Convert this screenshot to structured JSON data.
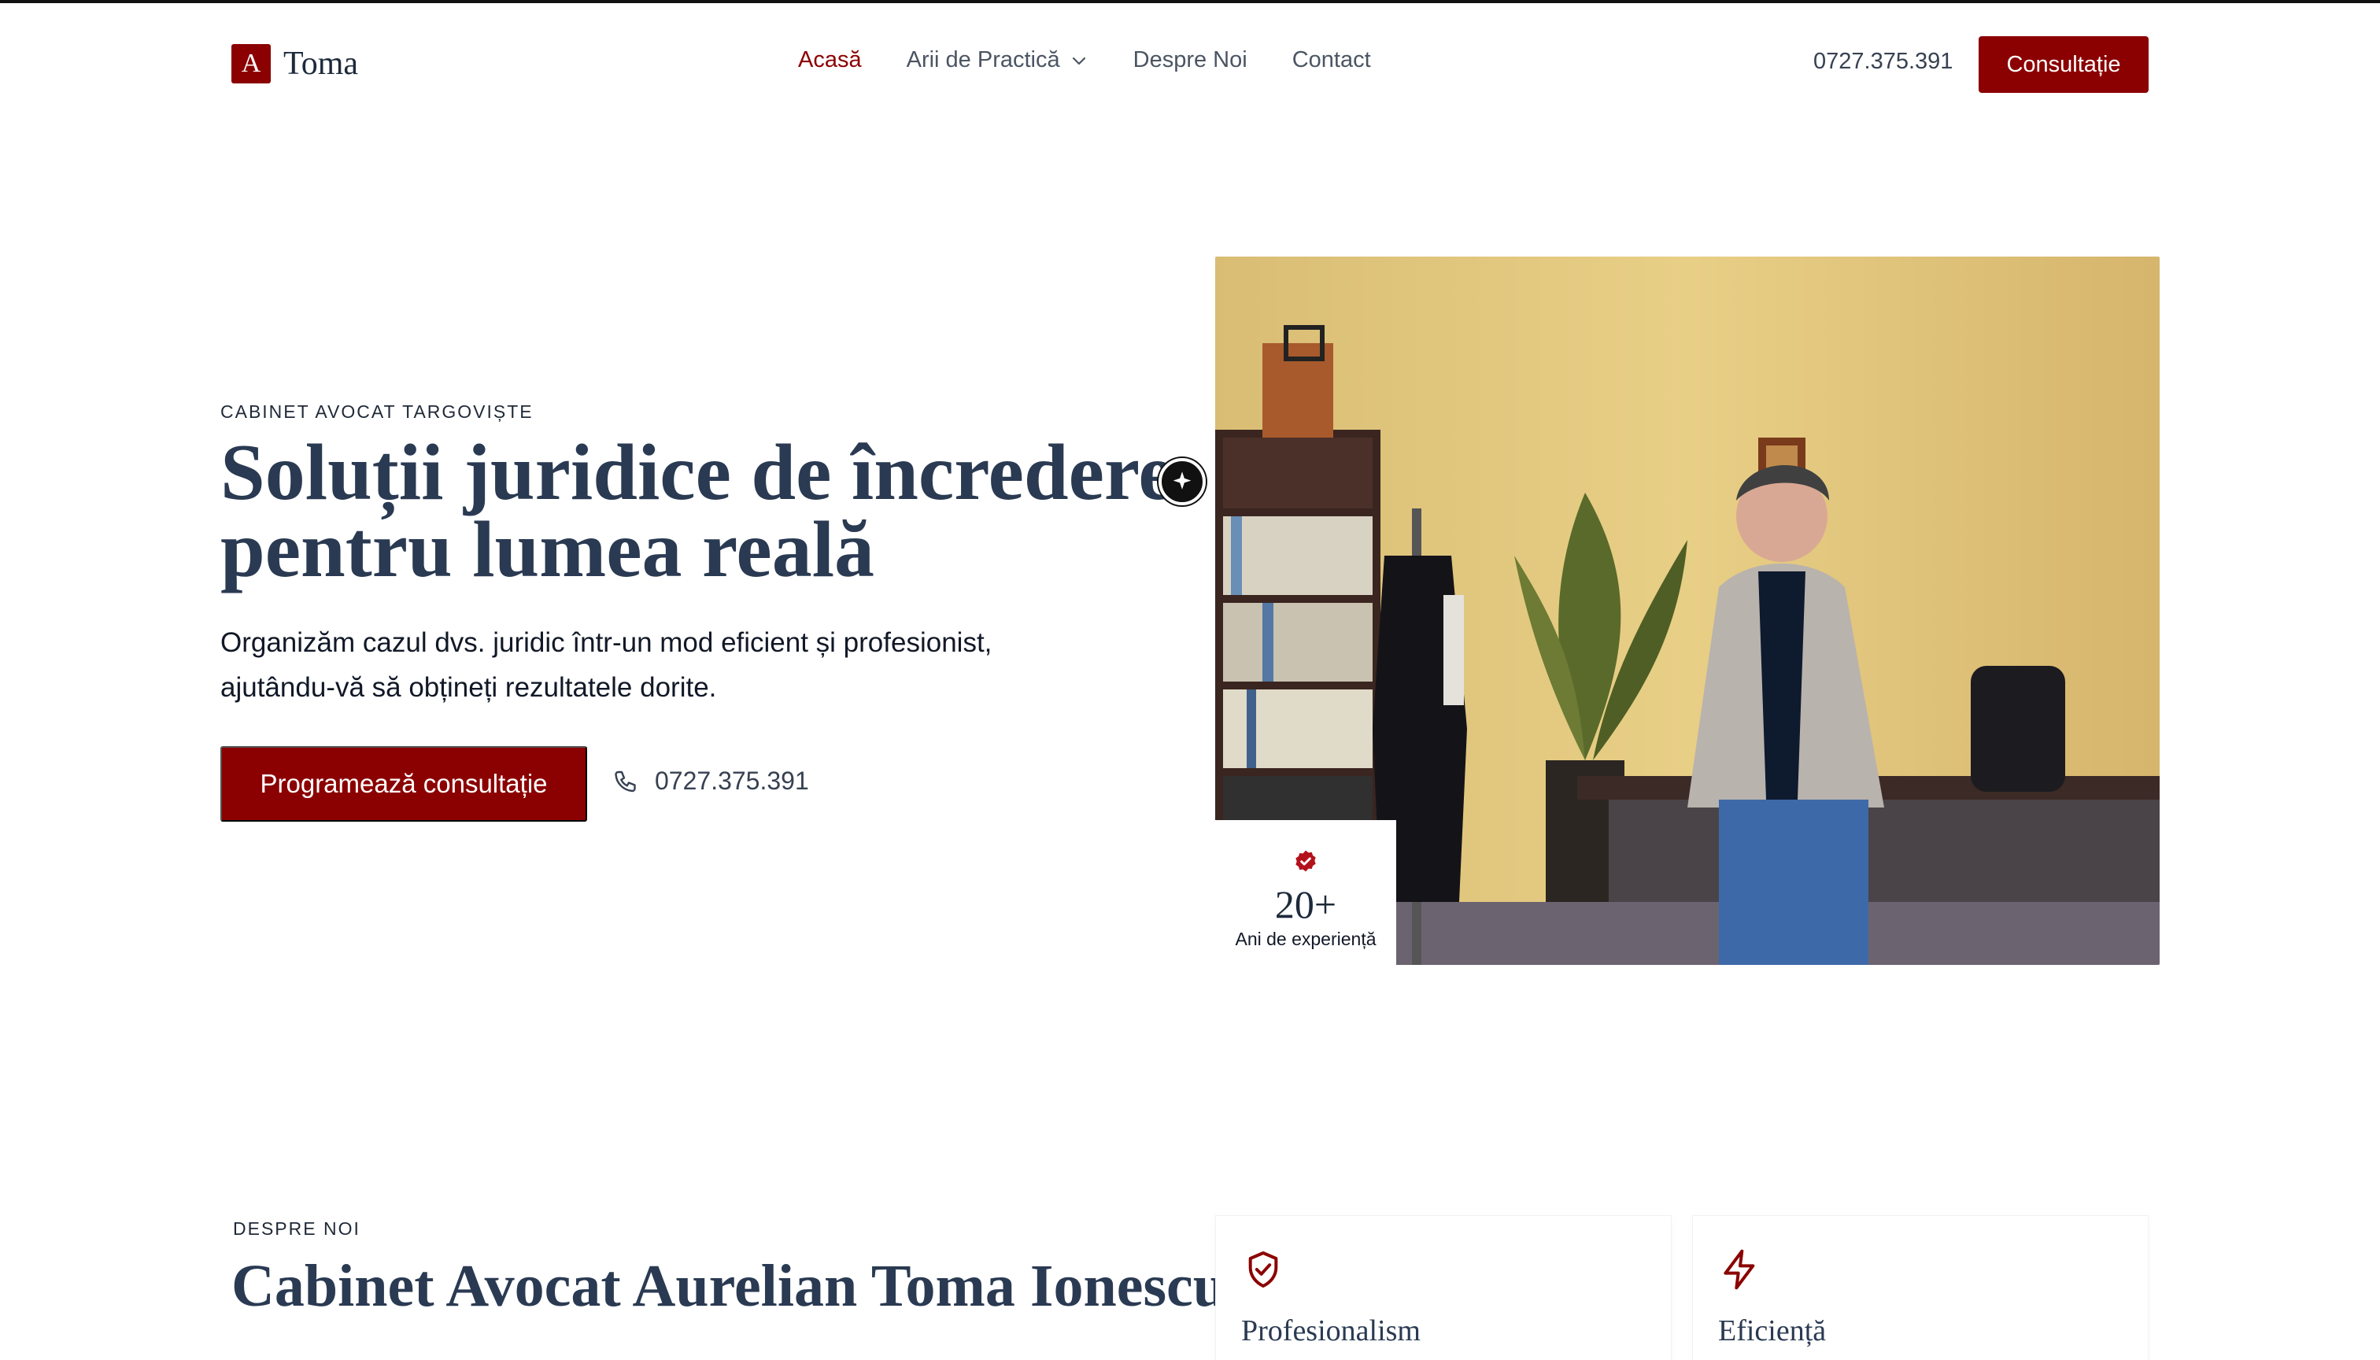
{
  "header": {
    "logo_mark": "A",
    "logo_text": "Toma",
    "nav": [
      {
        "label": "Acasă",
        "active": true
      },
      {
        "label": "Arii de Practică",
        "has_dropdown": true
      },
      {
        "label": "Despre Noi"
      },
      {
        "label": "Contact"
      }
    ],
    "phone": "0727.375.391",
    "cta": "Consultație"
  },
  "hero": {
    "eyebrow": "CABINET AVOCAT TARGOVIȘTE",
    "title_line1": "Soluții juridice de încredere",
    "title_line2": "pentru lumea reală",
    "subtitle_line1": "Organizăm cazul dvs. juridic într-un mod eficient și profesionist,",
    "subtitle_line2": "ajutându-vă să obțineți rezultatele dorite.",
    "cta": "Programează consultație",
    "phone": "0727.375.391",
    "experience_number": "20+",
    "experience_label": "Ani de experiență"
  },
  "about": {
    "eyebrow": "DESPRE NOI",
    "title": "Cabinet Avocat Aurelian Toma Ionescu",
    "features": [
      {
        "icon": "shield-check-icon",
        "title": "Profesionalism"
      },
      {
        "icon": "lightning-icon",
        "title": "Eficiență"
      }
    ]
  },
  "colors": {
    "accent": "#8b0000",
    "heading": "#2a3a52"
  }
}
